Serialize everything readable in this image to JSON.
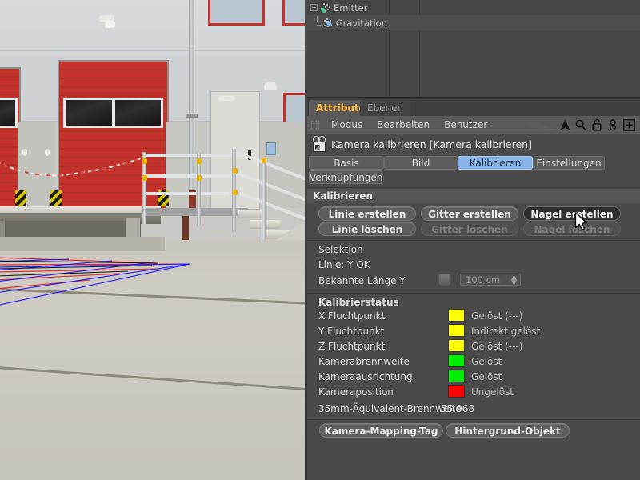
{
  "app": {
    "object_manager": {
      "rows": [
        {
          "label": "Emitter",
          "icon": "emitter-particle-icon",
          "expander": "+",
          "visibility_dot": "gray-dot",
          "render_dots": [
            "red-dot",
            "gray-dot"
          ],
          "tag_check": "✔"
        },
        {
          "label": "Gravitation",
          "icon": "gravitation-field-icon",
          "expander": "",
          "visibility_dot": "gray-dot",
          "render_dots": [
            "gray-dot",
            "gray-dot"
          ],
          "tag_check": "✔"
        }
      ]
    },
    "attribute_manager": {
      "tabs": [
        {
          "label": "Attribute",
          "active": true
        },
        {
          "label": "Ebenen",
          "active": false
        }
      ],
      "menu": {
        "grip_icon": "drag-grip-icon",
        "items": [
          "Modus",
          "Bearbeiten",
          "Benutzer"
        ],
        "icons": [
          "ghost-icon",
          "pointer-arrow-icon",
          "search-icon",
          "unlock-icon",
          "chain-link-icon",
          "add-box-icon"
        ]
      },
      "object_title": "Kamera kalibrieren [Kamera kalibrieren]",
      "object_icon": "camera-calibrator-icon",
      "parameter_tabs": [
        {
          "label": "Basis",
          "active": false
        },
        {
          "label": "Bild",
          "active": false
        },
        {
          "label": "Kalibrieren",
          "active": true
        },
        {
          "label": "Einstellungen",
          "active": false
        },
        {
          "label": "Verknüpfungen",
          "active": false
        }
      ],
      "groups": {
        "calibrate": {
          "title": "Kalibrieren",
          "buttons": [
            {
              "label": "Linie erstellen",
              "state": "normal"
            },
            {
              "label": "Gitter erstellen",
              "state": "normal"
            },
            {
              "label": "Nagel erstellen",
              "state": "hover"
            },
            {
              "label": "Linie löschen",
              "state": "normal"
            },
            {
              "label": "Gitter löschen",
              "state": "disabled"
            },
            {
              "label": "Nagel löschen",
              "state": "disabled"
            }
          ]
        },
        "selection": {
          "title": "Selektion",
          "line_status_label": "Linie: Y OK",
          "known_length_label": "Bekannte Länge  Y",
          "known_length_checked": false,
          "known_length_value": "100 cm",
          "spinner_icon": "spinner-updown-icon"
        },
        "status": {
          "title": "Kalibrierstatus",
          "rows": [
            {
              "label": "X Fluchtpunkt",
              "color": "#ffff00",
              "value": "Gelöst (---)"
            },
            {
              "label": "Y Fluchtpunkt",
              "color": "#ffff00",
              "value": "Indirekt gelöst"
            },
            {
              "label": "Z Fluchtpunkt",
              "color": "#ffff00",
              "value": "Gelöst (---)"
            },
            {
              "label": "Kamerabrennweite",
              "color": "#00ee00",
              "value": "Gelöst"
            },
            {
              "label": "Kameraausrichtung",
              "color": "#00ee00",
              "value": "Gelöst"
            },
            {
              "label": "Kameraposition",
              "color": "#ff0000",
              "value": "Ungelöst"
            }
          ],
          "focal_label": "35mm-Äquivalent-Brennweite",
          "focal_value": "55.968"
        },
        "footer_buttons": [
          {
            "label": "Kamera-Mapping-Tag"
          },
          {
            "label": "Hintergrund-Objekt"
          }
        ]
      }
    },
    "viewport": {
      "name": "camera-calibrator-viewport",
      "overlay": {
        "horizontal_line_color": "#e02020",
        "diagonal_line_color": "#1a1aff",
        "description": "perspective calibration grid over loading dock photo"
      },
      "cursor_icon": "mouse-pointer-arrow"
    }
  }
}
